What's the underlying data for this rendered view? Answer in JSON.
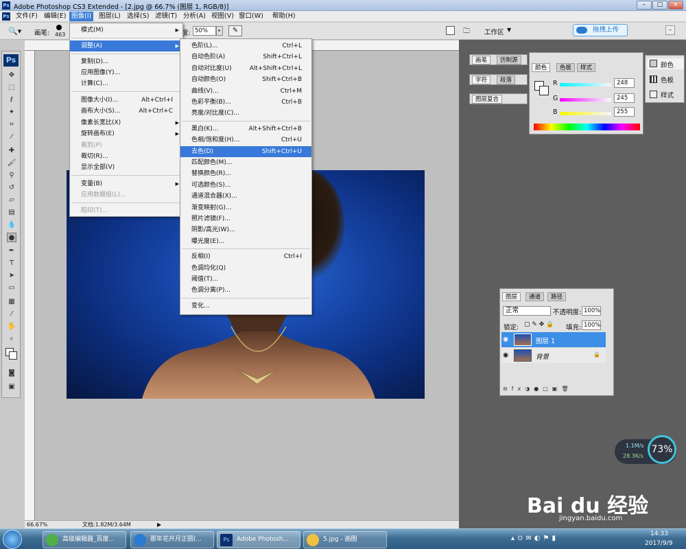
{
  "window": {
    "title": "Adobe Photoshop CS3 Extended - [2.jpg @ 66.7% (图层 1, RGB/8)]",
    "app_icon": "Ps",
    "controls": [
      "–",
      "□",
      "×"
    ]
  },
  "menubar": {
    "items": [
      "文件(F)",
      "编辑(E)",
      "图像(I)",
      "图层(L)",
      "选择(S)",
      "滤镜(T)",
      "分析(A)",
      "视图(V)",
      "窗口(W)",
      "帮助(H)"
    ],
    "active": "图像(I)"
  },
  "options": {
    "brush_label": "画笔:",
    "brush_size": "463",
    "opacity_label": "度:",
    "opacity_value": "50%",
    "workspace_label": "工作区",
    "upload_button": "拖拽上传"
  },
  "image_menu": {
    "items": [
      "模式(M)",
      "调整(A)",
      "复制(D)...",
      "应用图像(Y)...",
      "计算(C)...",
      "图像大小(I)...",
      "画布大小(S)...",
      "像素长宽比(X)",
      "旋转画布(E)",
      "裁剪(P)",
      "裁切(R)...",
      "显示全部(V)",
      "变量(B)",
      "应用数据组(L)...",
      "陷印(T)..."
    ],
    "shortcuts": {
      "图像大小(I)...": "Alt+Ctrl+I",
      "画布大小(S)...": "Alt+Ctrl+C"
    },
    "highlighted": "调整(A)"
  },
  "adjust_menu": {
    "items": [
      "色阶(L)...",
      "自动色阶(A)",
      "自动对比度(U)",
      "自动颜色(O)",
      "曲线(V)...",
      "色彩平衡(B)...",
      "亮度/对比度(C)...",
      "黑白(K)...",
      "色相/饱和度(H)...",
      "去色(D)",
      "匹配颜色(M)...",
      "替换颜色(R)...",
      "可选颜色(S)...",
      "通道混合器(X)...",
      "渐变映射(G)...",
      "照片滤镜(F)...",
      "阴影/高光(W)...",
      "曝光度(E)...",
      "反相(I)",
      "色调均化(Q)",
      "阈值(T)...",
      "色调分离(P)...",
      "变化..."
    ],
    "shortcuts": [
      "Ctrl+L",
      "Shift+Ctrl+L",
      "Alt+Shift+Ctrl+L",
      "Shift+Ctrl+B",
      "Ctrl+M",
      "Ctrl+B",
      "",
      "Alt+Shift+Ctrl+B",
      "Ctrl+U",
      "Shift+Ctrl+U",
      "",
      "",
      "",
      "",
      "",
      "",
      "",
      "",
      "Ctrl+I",
      "",
      "",
      "",
      ""
    ],
    "highlighted": "去色(D)"
  },
  "panels": {
    "top_tabs": [
      "画笔",
      "仿制源"
    ],
    "mid_tabs": [
      "字符",
      "段落"
    ],
    "comp_tab": "图层复合",
    "color_tabs": [
      "颜色",
      "色板",
      "样式"
    ],
    "color": {
      "r_label": "R",
      "g_label": "G",
      "b_label": "B",
      "r": "248",
      "g": "245",
      "b": "255"
    },
    "side_buttons": [
      "颜色",
      "色板",
      "样式"
    ],
    "layers_tabs": [
      "图层",
      "通道",
      "路径"
    ],
    "blend_mode": "正常",
    "opacity_label": "不透明度:",
    "opacity_value": "100%",
    "lock_label": "锁定:",
    "fill_label": "填充:",
    "fill_value": "100%",
    "layers": [
      {
        "name": "图层 1",
        "selected": true
      },
      {
        "name": "背景",
        "selected": false
      }
    ]
  },
  "status": {
    "zoom": "66.67%",
    "doc": "文档:1.82M/3.64M"
  },
  "network_widget": {
    "up": "1.1M/s",
    "down": "28.3K/s",
    "percent": "73%"
  },
  "taskbar": {
    "tasks": [
      "高级编辑器_百度...",
      "那年花开月正圆(...",
      "Adobe Photosh...",
      "5.jpg - 画图"
    ],
    "time": "14:33",
    "date": "2017/9/9"
  },
  "watermark": {
    "brand": "Bai du 经验",
    "url": "jingyan.baidu.com"
  }
}
